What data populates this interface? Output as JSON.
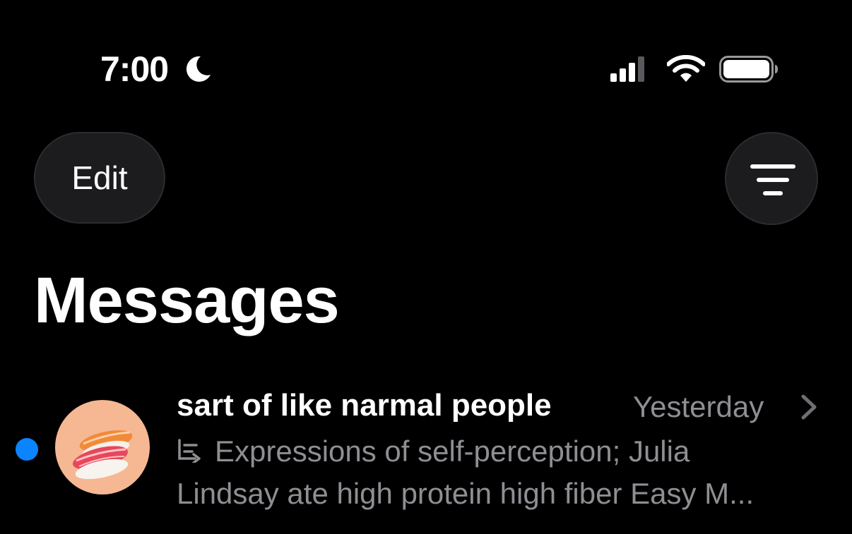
{
  "status_bar": {
    "time": "7:00",
    "focus_icon": "moon-icon",
    "signal_icon": "cellular-signal-icon",
    "wifi_icon": "wifi-icon",
    "battery_icon": "battery-icon"
  },
  "header": {
    "edit_label": "Edit",
    "filter_icon": "filter-icon",
    "title": "Messages"
  },
  "conversations": [
    {
      "name": "sart of like narmal people",
      "timestamp": "Yesterday",
      "unread": true,
      "avatar": "sushi-avatar",
      "preview_icon": "thread-reply-icon",
      "preview_line1": "Expressions of self-perception; Julia",
      "preview_line2": "Lindsay ate high protein high fiber Easy M..."
    }
  ],
  "colors": {
    "background": "#000000",
    "button_bg": "#1c1c1e",
    "secondary_text": "#8e8e93",
    "unread_dot": "#0a84ff"
  }
}
